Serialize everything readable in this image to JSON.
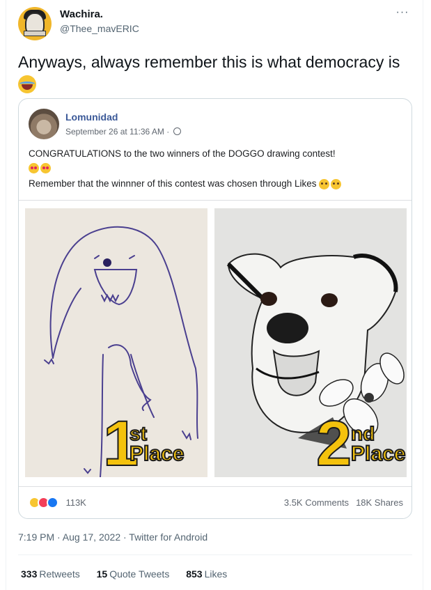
{
  "author": {
    "name": "Wachira.",
    "handle": "@Thee_mavERIC"
  },
  "tweet": {
    "text": "Anyways, always remember this is what democracy is",
    "emoji": "face-with-tears-of-joy"
  },
  "embedded_post": {
    "page_name": "Lomunidad",
    "date": "September 26 at 11:36 AM ·",
    "line1": "CONGRATULATIONS to the two winners of the DOGGO drawing contest!",
    "line2": "Remember that the winnner of this contest was chosen through Likes",
    "images": [
      {
        "subject": "child-drawing-of-dog",
        "place_number": "1",
        "place_suffix": "st",
        "place_word": "Place"
      },
      {
        "subject": "realistic-ink-drawing-of-dog",
        "place_number": "2",
        "place_suffix": "nd",
        "place_word": "Place"
      }
    ],
    "reaction_count": "113K",
    "comments": "3.5K Comments",
    "shares": "18K Shares"
  },
  "timestamp": "7:19 PM · Aug 17, 2022 · Twitter for Android",
  "stats": {
    "retweets": {
      "count": "333",
      "label": "Retweets"
    },
    "quote_tweets": {
      "count": "15",
      "label": "Quote Tweets"
    },
    "likes": {
      "count": "853",
      "label": "Likes"
    }
  },
  "colors": {
    "fb_blue": "#3b5998",
    "gold": "#f4c20d",
    "muted": "#536471"
  }
}
